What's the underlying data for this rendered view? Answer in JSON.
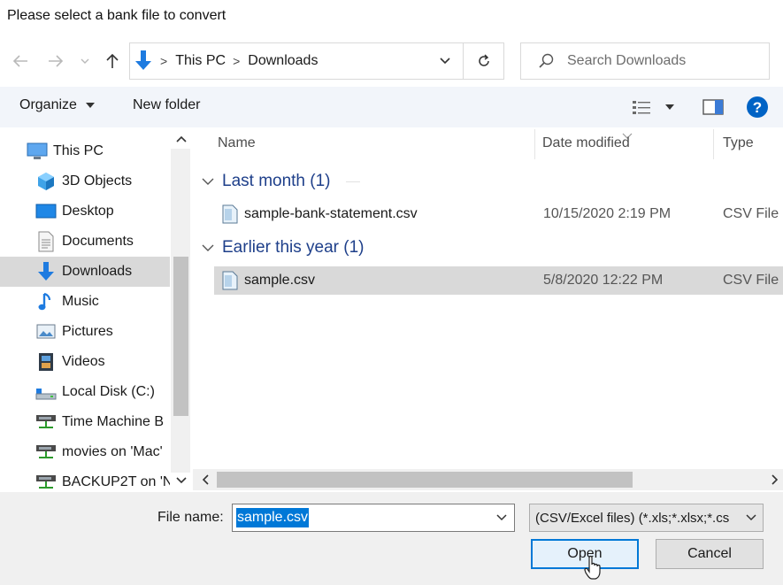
{
  "dialog": {
    "title": "Please select a bank file to convert"
  },
  "address": {
    "crumbs": [
      "This PC",
      "Downloads"
    ],
    "search_placeholder": "Search Downloads"
  },
  "toolbar": {
    "organize_label": "Organize",
    "new_folder_label": "New folder"
  },
  "nav": {
    "items": [
      {
        "label": "This PC",
        "icon": "this-pc-icon"
      },
      {
        "label": "3D Objects",
        "icon": "3d-objects-icon"
      },
      {
        "label": "Desktop",
        "icon": "desktop-icon"
      },
      {
        "label": "Documents",
        "icon": "documents-icon"
      },
      {
        "label": "Downloads",
        "icon": "downloads-icon",
        "selected": true
      },
      {
        "label": "Music",
        "icon": "music-icon"
      },
      {
        "label": "Pictures",
        "icon": "pictures-icon"
      },
      {
        "label": "Videos",
        "icon": "videos-icon"
      },
      {
        "label": "Local Disk (C:)",
        "icon": "local-disk-icon"
      },
      {
        "label": "Time Machine B",
        "icon": "network-drive-icon"
      },
      {
        "label": "movies on 'Mac'",
        "icon": "network-drive-icon"
      },
      {
        "label": "BACKUP2T on 'N",
        "icon": "network-drive-icon"
      }
    ]
  },
  "columns": {
    "name": "Name",
    "date": "Date modified",
    "type": "Type"
  },
  "groups": [
    {
      "label": "Last month (1)",
      "files": [
        {
          "name": "sample-bank-statement.csv",
          "date": "10/15/2020 2:19 PM",
          "type": "CSV File"
        }
      ]
    },
    {
      "label": "Earlier this year (1)",
      "files": [
        {
          "name": "sample.csv",
          "date": "5/8/2020 12:22 PM",
          "type": "CSV File",
          "selected": true
        }
      ]
    }
  ],
  "footer": {
    "file_name_label": "File name:",
    "file_name_value": "sample.csv",
    "filter_value": "(CSV/Excel files) (*.xls;*.xlsx;*.cs",
    "open_label": "Open",
    "cancel_label": "Cancel"
  },
  "colors": {
    "accent": "#0078d7",
    "group_text": "#1e3f8a",
    "selection": "#d9d9d9"
  }
}
